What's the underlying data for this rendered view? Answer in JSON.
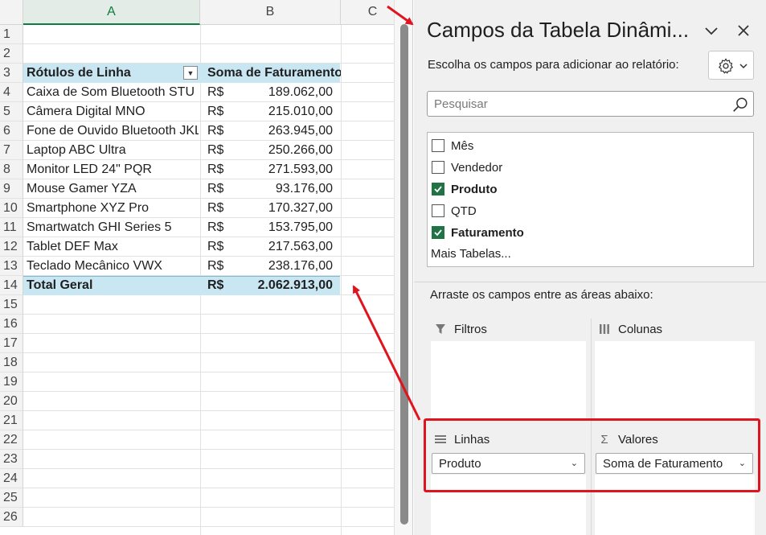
{
  "sheet": {
    "columns": [
      "A",
      "B",
      "C"
    ],
    "rows": [
      "1",
      "2",
      "3",
      "4",
      "5",
      "6",
      "7",
      "8",
      "9",
      "10",
      "11",
      "12",
      "13",
      "14",
      "15",
      "16",
      "17",
      "18",
      "19",
      "20",
      "21",
      "22",
      "23",
      "24",
      "25",
      "26"
    ],
    "header": {
      "label": "Rótulos de Linha",
      "value": "Soma de Faturamento"
    },
    "items": [
      {
        "label": "Caixa de Som Bluetooth STU",
        "cur": "R$",
        "value": "189.062,00"
      },
      {
        "label": "Câmera Digital MNO",
        "cur": "R$",
        "value": "215.010,00"
      },
      {
        "label": "Fone de Ouvido Bluetooth JKL",
        "cur": "R$",
        "value": "263.945,00"
      },
      {
        "label": "Laptop ABC Ultra",
        "cur": "R$",
        "value": "250.266,00"
      },
      {
        "label": "Monitor LED 24\" PQR",
        "cur": "R$",
        "value": "271.593,00"
      },
      {
        "label": "Mouse Gamer YZA",
        "cur": "R$",
        "value": "93.176,00"
      },
      {
        "label": "Smartphone XYZ Pro",
        "cur": "R$",
        "value": "170.327,00"
      },
      {
        "label": "Smartwatch GHI Series 5",
        "cur": "R$",
        "value": "153.795,00"
      },
      {
        "label": "Tablet DEF Max",
        "cur": "R$",
        "value": "217.563,00"
      },
      {
        "label": "Teclado Mecânico VWX",
        "cur": "R$",
        "value": "238.176,00"
      }
    ],
    "total": {
      "label": "Total Geral",
      "cur": "R$",
      "value": "2.062.913,00"
    }
  },
  "panel": {
    "title": "Campos da Tabela Dinâmi...",
    "choose_label": "Escolha os campos para adicionar ao relatório:",
    "search_placeholder": "Pesquisar",
    "fields": [
      {
        "name": "Mês",
        "checked": false
      },
      {
        "name": "Vendedor",
        "checked": false
      },
      {
        "name": "Produto",
        "checked": true
      },
      {
        "name": "QTD",
        "checked": false
      },
      {
        "name": "Faturamento",
        "checked": true
      }
    ],
    "more_tables": "Mais Tabelas...",
    "drag_label": "Arraste os campos entre as áreas abaixo:",
    "areas": {
      "filters": "Filtros",
      "columns": "Colunas",
      "rows": "Linhas",
      "values": "Valores"
    },
    "rows_item": "Produto",
    "values_item": "Soma de Faturamento"
  },
  "colors": {
    "accent": "#217346",
    "highlight": "#c9e6f3",
    "annotation": "#e0141e"
  }
}
